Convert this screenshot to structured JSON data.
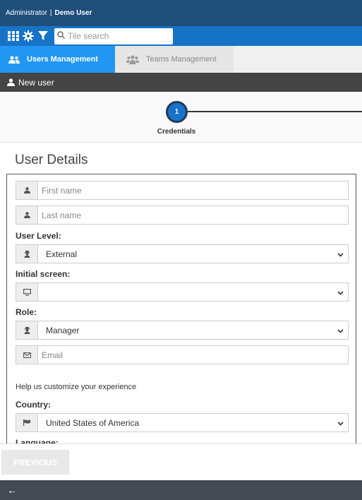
{
  "header": {
    "role": "Administrator",
    "separator": "|",
    "user": "Demo User"
  },
  "toolbar": {
    "icons": [
      "grid-icon",
      "gear-icon",
      "filter-icon"
    ],
    "search_placeholder": "Tile search"
  },
  "tabs": [
    {
      "label": "Users Management",
      "icon": "users-icon",
      "active": true
    },
    {
      "label": "Teams Management",
      "icon": "teams-icon",
      "active": false
    }
  ],
  "subbar": {
    "label": "New user",
    "icon": "user-icon"
  },
  "stepper": {
    "number": "1",
    "label": "Credentials"
  },
  "section_title": "User Details",
  "form": {
    "first_name_placeholder": "First name",
    "last_name_placeholder": "Last name",
    "user_level_label": "User Level:",
    "user_level_value": "External",
    "initial_screen_label": "Initial screen:",
    "initial_screen_value": "",
    "role_label": "Role:",
    "role_value": "Manager",
    "email_placeholder": "Email",
    "help_text": "Help us customize your experience",
    "country_label": "Country:",
    "country_value": "United States of America",
    "language_label": "Language:"
  },
  "buttons": {
    "previous": "PREVIOUS"
  },
  "footer": {
    "back_arrow": "←"
  },
  "colors": {
    "header_bg": "#1f4e79",
    "toolbar_bg": "#1673c8",
    "active_tab": "#2196f3",
    "subbar_bg": "#444444"
  }
}
